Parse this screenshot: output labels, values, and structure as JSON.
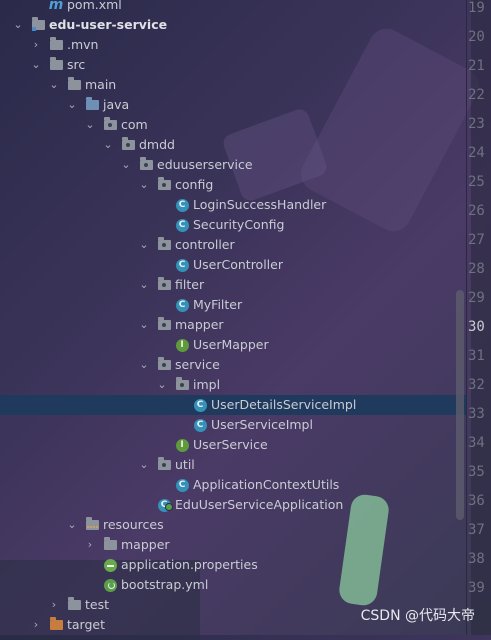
{
  "tree": {
    "pom": "pom.xml",
    "module": "edu-user-service",
    "mvn": ".mvn",
    "src": "src",
    "main": "main",
    "java": "java",
    "com": "com",
    "dmdd": "dmdd",
    "eduuserservice": "eduuserservice",
    "config": "config",
    "login_handler": "LoginSuccessHandler",
    "security_config": "SecurityConfig",
    "controller": "controller",
    "user_controller": "UserController",
    "filter": "filter",
    "my_filter": "MyFilter",
    "mapper": "mapper",
    "user_mapper": "UserMapper",
    "service": "service",
    "impl": "impl",
    "user_details_impl": "UserDetailsServiceImpl",
    "user_service_impl": "UserServiceImpl",
    "user_service": "UserService",
    "util": "util",
    "app_context_utils": "ApplicationContextUtils",
    "app_class": "EduUserServiceApplication",
    "resources": "resources",
    "res_mapper": "mapper",
    "app_properties": "application.properties",
    "bootstrap": "bootstrap.yml",
    "test": "test",
    "target": "target"
  },
  "badges": {
    "class": "C",
    "interface": "I"
  },
  "line_numbers": [
    "19",
    "20",
    "21",
    "22",
    "23",
    "24",
    "25",
    "26",
    "27",
    "28",
    "29",
    "30",
    "31",
    "32",
    "33",
    "34",
    "35",
    "36",
    "37",
    "38",
    "39"
  ],
  "watermark": "CSDN @代码大帝",
  "colors": {
    "selection": "#1f3a5c",
    "class_badge": "#3591b7",
    "interface_badge": "#5f9b3c"
  }
}
